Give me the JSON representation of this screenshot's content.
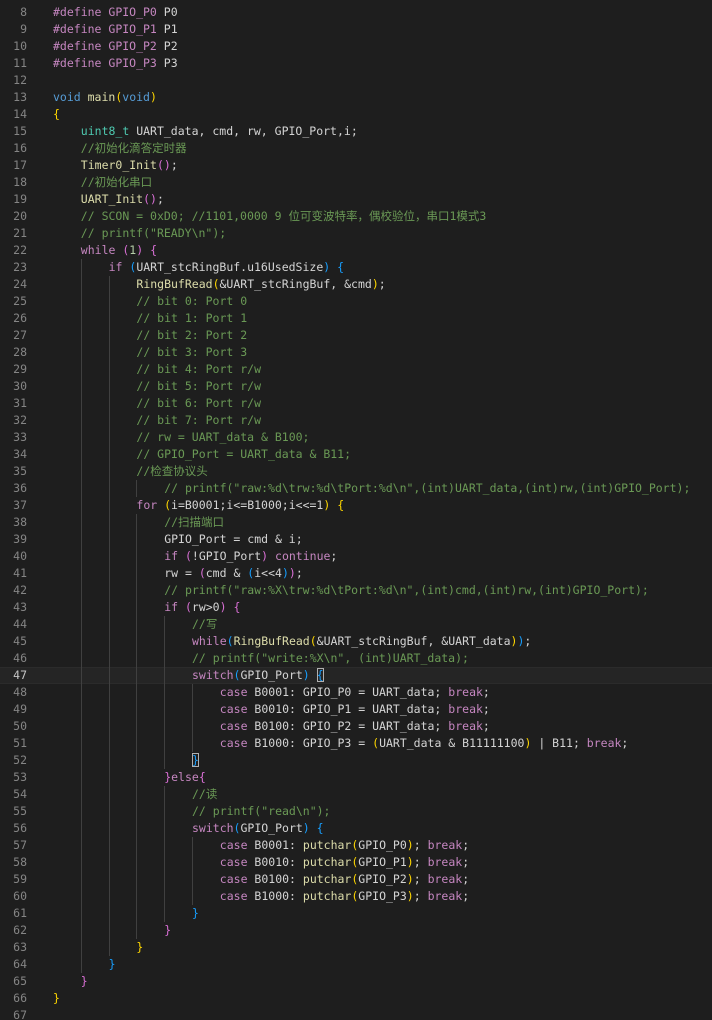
{
  "editor": {
    "language": "c",
    "current_line": 47,
    "lines": [
      {
        "no": "8",
        "indent": 0,
        "tokens": [
          [
            "pp",
            "#define "
          ],
          [
            "macro",
            "GPIO_P0"
          ],
          [
            "plain",
            " P0"
          ]
        ]
      },
      {
        "no": "9",
        "indent": 0,
        "tokens": [
          [
            "pp",
            "#define "
          ],
          [
            "macro",
            "GPIO_P1"
          ],
          [
            "plain",
            " P1"
          ]
        ]
      },
      {
        "no": "10",
        "indent": 0,
        "tokens": [
          [
            "pp",
            "#define "
          ],
          [
            "macro",
            "GPIO_P2"
          ],
          [
            "plain",
            " P2"
          ]
        ]
      },
      {
        "no": "11",
        "indent": 0,
        "tokens": [
          [
            "pp",
            "#define "
          ],
          [
            "macro",
            "GPIO_P3"
          ],
          [
            "plain",
            " P3"
          ]
        ]
      },
      {
        "no": "12",
        "indent": 0,
        "tokens": []
      },
      {
        "no": "13",
        "indent": 0,
        "tokens": [
          [
            "kw",
            "void "
          ],
          [
            "fn",
            "main"
          ],
          [
            "br1",
            "("
          ],
          [
            "kw",
            "void"
          ],
          [
            "br1",
            ")"
          ]
        ]
      },
      {
        "no": "14",
        "indent": 0,
        "tokens": [
          [
            "br1",
            "{"
          ]
        ]
      },
      {
        "no": "15",
        "indent": 1,
        "tokens": [
          [
            "type",
            "uint8_t "
          ],
          [
            "plain",
            "UART_data, cmd, rw, GPIO_Port,i;"
          ]
        ]
      },
      {
        "no": "16",
        "indent": 1,
        "tokens": [
          [
            "com",
            "//初始化滴答定时器"
          ]
        ]
      },
      {
        "no": "17",
        "indent": 1,
        "tokens": [
          [
            "fn",
            "Timer0_Init"
          ],
          [
            "br2",
            "()"
          ],
          [
            "plain",
            ";"
          ]
        ]
      },
      {
        "no": "18",
        "indent": 1,
        "tokens": [
          [
            "com",
            "//初始化串口"
          ]
        ]
      },
      {
        "no": "19",
        "indent": 1,
        "tokens": [
          [
            "fn",
            "UART_Init"
          ],
          [
            "br2",
            "()"
          ],
          [
            "plain",
            ";"
          ]
        ]
      },
      {
        "no": "20",
        "indent": 1,
        "tokens": [
          [
            "com",
            "// SCON = 0xD0; //1101,0000 9 位可变波特率，偶校验位，串口1模式3"
          ]
        ]
      },
      {
        "no": "21",
        "indent": 1,
        "tokens": [
          [
            "com",
            "// printf(\"READY\\n\");"
          ]
        ]
      },
      {
        "no": "22",
        "indent": 1,
        "tokens": [
          [
            "ctrl",
            "while "
          ],
          [
            "br2",
            "("
          ],
          [
            "num",
            "1"
          ],
          [
            "br2",
            ") {"
          ]
        ]
      },
      {
        "no": "23",
        "indent": 2,
        "tokens": [
          [
            "ctrl",
            "if "
          ],
          [
            "br3",
            "("
          ],
          [
            "plain",
            "UART_stcRingBuf.u16UsedSize"
          ],
          [
            "br3",
            ") {"
          ]
        ]
      },
      {
        "no": "24",
        "indent": 3,
        "tokens": [
          [
            "fn",
            "RingBufRead"
          ],
          [
            "br1",
            "("
          ],
          [
            "plain",
            "&UART_stcRingBuf, &cmd"
          ],
          [
            "br1",
            ")"
          ],
          [
            "plain",
            ";"
          ]
        ]
      },
      {
        "no": "25",
        "indent": 3,
        "tokens": [
          [
            "com",
            "// bit 0: Port 0"
          ]
        ]
      },
      {
        "no": "26",
        "indent": 3,
        "tokens": [
          [
            "com",
            "// bit 1: Port 1"
          ]
        ]
      },
      {
        "no": "27",
        "indent": 3,
        "tokens": [
          [
            "com",
            "// bit 2: Port 2"
          ]
        ]
      },
      {
        "no": "28",
        "indent": 3,
        "tokens": [
          [
            "com",
            "// bit 3: Port 3"
          ]
        ]
      },
      {
        "no": "29",
        "indent": 3,
        "tokens": [
          [
            "com",
            "// bit 4: Port r/w"
          ]
        ]
      },
      {
        "no": "30",
        "indent": 3,
        "tokens": [
          [
            "com",
            "// bit 5: Port r/w"
          ]
        ]
      },
      {
        "no": "31",
        "indent": 3,
        "tokens": [
          [
            "com",
            "// bit 6: Port r/w"
          ]
        ]
      },
      {
        "no": "32",
        "indent": 3,
        "tokens": [
          [
            "com",
            "// bit 7: Port r/w"
          ]
        ]
      },
      {
        "no": "33",
        "indent": 3,
        "tokens": [
          [
            "com",
            "// rw = UART_data & B100;"
          ]
        ]
      },
      {
        "no": "34",
        "indent": 3,
        "tokens": [
          [
            "com",
            "// GPIO_Port = UART_data & B11;"
          ]
        ]
      },
      {
        "no": "35",
        "indent": 3,
        "tokens": [
          [
            "com",
            "//检查协议头"
          ]
        ]
      },
      {
        "no": "36",
        "indent": 4,
        "tokens": [
          [
            "com",
            "// printf(\"raw:%d\\trw:%d\\tPort:%d\\n\",(int)UART_data,(int)rw,(int)GPIO_Port);"
          ]
        ]
      },
      {
        "no": "37",
        "indent": 3,
        "tokens": [
          [
            "ctrl",
            "for "
          ],
          [
            "br1",
            "("
          ],
          [
            "plain",
            "i=B0001;i<=B1000;i<<=1"
          ],
          [
            "br1",
            ") {"
          ]
        ]
      },
      {
        "no": "38",
        "indent": 4,
        "tokens": [
          [
            "com",
            "//扫描端口"
          ]
        ]
      },
      {
        "no": "39",
        "indent": 4,
        "tokens": [
          [
            "plain",
            "GPIO_Port = cmd & i;"
          ]
        ]
      },
      {
        "no": "40",
        "indent": 4,
        "tokens": [
          [
            "ctrl",
            "if "
          ],
          [
            "br2",
            "("
          ],
          [
            "plain",
            "!GPIO_Port"
          ],
          [
            "br2",
            ")"
          ],
          [
            "plain",
            " "
          ],
          [
            "ctrl",
            "continue"
          ],
          [
            "plain",
            ";"
          ]
        ]
      },
      {
        "no": "41",
        "indent": 4,
        "tokens": [
          [
            "plain",
            "rw = "
          ],
          [
            "br2",
            "("
          ],
          [
            "plain",
            "cmd & "
          ],
          [
            "br3",
            "("
          ],
          [
            "plain",
            "i<<4"
          ],
          [
            "br3",
            ")"
          ],
          [
            "br2",
            ")"
          ],
          [
            "plain",
            ";"
          ]
        ]
      },
      {
        "no": "42",
        "indent": 4,
        "tokens": [
          [
            "com",
            "// printf(\"raw:%X\\trw:%d\\tPort:%d\\n\",(int)cmd,(int)rw,(int)GPIO_Port);"
          ]
        ]
      },
      {
        "no": "43",
        "indent": 4,
        "tokens": [
          [
            "ctrl",
            "if "
          ],
          [
            "br2",
            "("
          ],
          [
            "plain",
            "rw>0"
          ],
          [
            "br2",
            ") {"
          ]
        ]
      },
      {
        "no": "44",
        "indent": 5,
        "tokens": [
          [
            "com",
            "//写"
          ]
        ]
      },
      {
        "no": "45",
        "indent": 5,
        "tokens": [
          [
            "ctrl",
            "while"
          ],
          [
            "br3",
            "("
          ],
          [
            "fn",
            "RingBufRead"
          ],
          [
            "br1",
            "("
          ],
          [
            "plain",
            "&UART_stcRingBuf, &UART_data"
          ],
          [
            "br1",
            ")"
          ],
          [
            "br3",
            ")"
          ],
          [
            "plain",
            ";"
          ]
        ]
      },
      {
        "no": "46",
        "indent": 5,
        "tokens": [
          [
            "com",
            "// printf(\"write:%X\\n\", (int)UART_data);"
          ]
        ]
      },
      {
        "no": "47",
        "indent": 5,
        "tokens": [
          [
            "ctrl",
            "switch"
          ],
          [
            "br3",
            "("
          ],
          [
            "plain",
            "GPIO_Port"
          ],
          [
            "br3",
            ")"
          ],
          [
            "plain",
            " "
          ],
          [
            "br3box",
            "{"
          ]
        ]
      },
      {
        "no": "48",
        "indent": 6,
        "tokens": [
          [
            "ctrl",
            "case "
          ],
          [
            "plain",
            "B0001: GPIO_P0 = UART_data; "
          ],
          [
            "ctrl",
            "break"
          ],
          [
            "plain",
            ";"
          ]
        ]
      },
      {
        "no": "49",
        "indent": 6,
        "tokens": [
          [
            "ctrl",
            "case "
          ],
          [
            "plain",
            "B0010: GPIO_P1 = UART_data; "
          ],
          [
            "ctrl",
            "break"
          ],
          [
            "plain",
            ";"
          ]
        ]
      },
      {
        "no": "50",
        "indent": 6,
        "tokens": [
          [
            "ctrl",
            "case "
          ],
          [
            "plain",
            "B0100: GPIO_P2 = UART_data; "
          ],
          [
            "ctrl",
            "break"
          ],
          [
            "plain",
            ";"
          ]
        ]
      },
      {
        "no": "51",
        "indent": 6,
        "tokens": [
          [
            "ctrl",
            "case "
          ],
          [
            "plain",
            "B1000: GPIO_P3 = "
          ],
          [
            "br1",
            "("
          ],
          [
            "plain",
            "UART_data & B11111100"
          ],
          [
            "br1",
            ")"
          ],
          [
            "plain",
            " | B11; "
          ],
          [
            "ctrl",
            "break"
          ],
          [
            "plain",
            ";"
          ]
        ]
      },
      {
        "no": "52",
        "indent": 5,
        "tokens": [
          [
            "br3box",
            "}"
          ]
        ]
      },
      {
        "no": "53",
        "indent": 4,
        "tokens": [
          [
            "br2",
            "}"
          ],
          [
            "ctrl",
            "else"
          ],
          [
            "br2",
            "{"
          ]
        ]
      },
      {
        "no": "54",
        "indent": 5,
        "tokens": [
          [
            "com",
            "//读"
          ]
        ]
      },
      {
        "no": "55",
        "indent": 5,
        "tokens": [
          [
            "com",
            "// printf(\"read\\n\");"
          ]
        ]
      },
      {
        "no": "56",
        "indent": 5,
        "tokens": [
          [
            "ctrl",
            "switch"
          ],
          [
            "br3",
            "("
          ],
          [
            "plain",
            "GPIO_Port"
          ],
          [
            "br3",
            ") {"
          ]
        ]
      },
      {
        "no": "57",
        "indent": 6,
        "tokens": [
          [
            "ctrl",
            "case "
          ],
          [
            "plain",
            "B0001: "
          ],
          [
            "fn",
            "putchar"
          ],
          [
            "br1",
            "("
          ],
          [
            "plain",
            "GPIO_P0"
          ],
          [
            "br1",
            ")"
          ],
          [
            "plain",
            "; "
          ],
          [
            "ctrl",
            "break"
          ],
          [
            "plain",
            ";"
          ]
        ]
      },
      {
        "no": "58",
        "indent": 6,
        "tokens": [
          [
            "ctrl",
            "case "
          ],
          [
            "plain",
            "B0010: "
          ],
          [
            "fn",
            "putchar"
          ],
          [
            "br1",
            "("
          ],
          [
            "plain",
            "GPIO_P1"
          ],
          [
            "br1",
            ")"
          ],
          [
            "plain",
            "; "
          ],
          [
            "ctrl",
            "break"
          ],
          [
            "plain",
            ";"
          ]
        ]
      },
      {
        "no": "59",
        "indent": 6,
        "tokens": [
          [
            "ctrl",
            "case "
          ],
          [
            "plain",
            "B0100: "
          ],
          [
            "fn",
            "putchar"
          ],
          [
            "br1",
            "("
          ],
          [
            "plain",
            "GPIO_P2"
          ],
          [
            "br1",
            ")"
          ],
          [
            "plain",
            "; "
          ],
          [
            "ctrl",
            "break"
          ],
          [
            "plain",
            ";"
          ]
        ]
      },
      {
        "no": "60",
        "indent": 6,
        "tokens": [
          [
            "ctrl",
            "case "
          ],
          [
            "plain",
            "B1000: "
          ],
          [
            "fn",
            "putchar"
          ],
          [
            "br1",
            "("
          ],
          [
            "plain",
            "GPIO_P3"
          ],
          [
            "br1",
            ")"
          ],
          [
            "plain",
            "; "
          ],
          [
            "ctrl",
            "break"
          ],
          [
            "plain",
            ";"
          ]
        ]
      },
      {
        "no": "61",
        "indent": 5,
        "tokens": [
          [
            "br3",
            "}"
          ]
        ]
      },
      {
        "no": "62",
        "indent": 4,
        "tokens": [
          [
            "br2",
            "}"
          ]
        ]
      },
      {
        "no": "63",
        "indent": 3,
        "tokens": [
          [
            "br1",
            "}"
          ]
        ]
      },
      {
        "no": "64",
        "indent": 2,
        "tokens": [
          [
            "br3",
            "}"
          ]
        ]
      },
      {
        "no": "65",
        "indent": 1,
        "tokens": [
          [
            "br2",
            "}"
          ]
        ]
      },
      {
        "no": "66",
        "indent": 0,
        "tokens": [
          [
            "br1",
            "}"
          ]
        ]
      },
      {
        "no": "67",
        "indent": 0,
        "tokens": []
      }
    ]
  }
}
